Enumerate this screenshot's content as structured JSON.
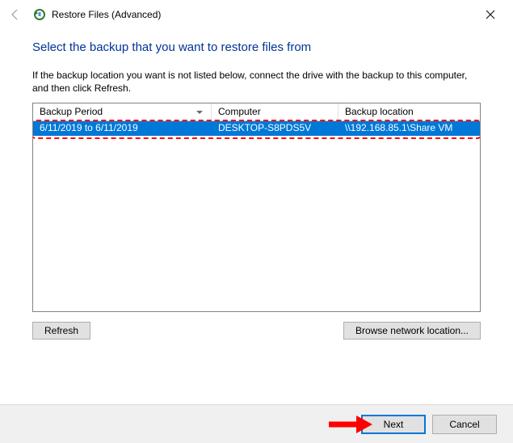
{
  "window": {
    "title": "Restore Files (Advanced)"
  },
  "page": {
    "heading": "Select the backup that you want to restore files from",
    "instructions": "If the backup location you want is not listed below, connect the drive with the backup to this computer, and then click Refresh."
  },
  "grid": {
    "columns": {
      "period": "Backup Period",
      "computer": "Computer",
      "location": "Backup location"
    },
    "rows": [
      {
        "period": "6/11/2019 to 6/11/2019",
        "computer": "DESKTOP-S8PDS5V",
        "location": "\\\\192.168.85.1\\Share VM"
      }
    ]
  },
  "buttons": {
    "refresh": "Refresh",
    "browse": "Browse network location...",
    "next": "Next",
    "cancel": "Cancel"
  }
}
